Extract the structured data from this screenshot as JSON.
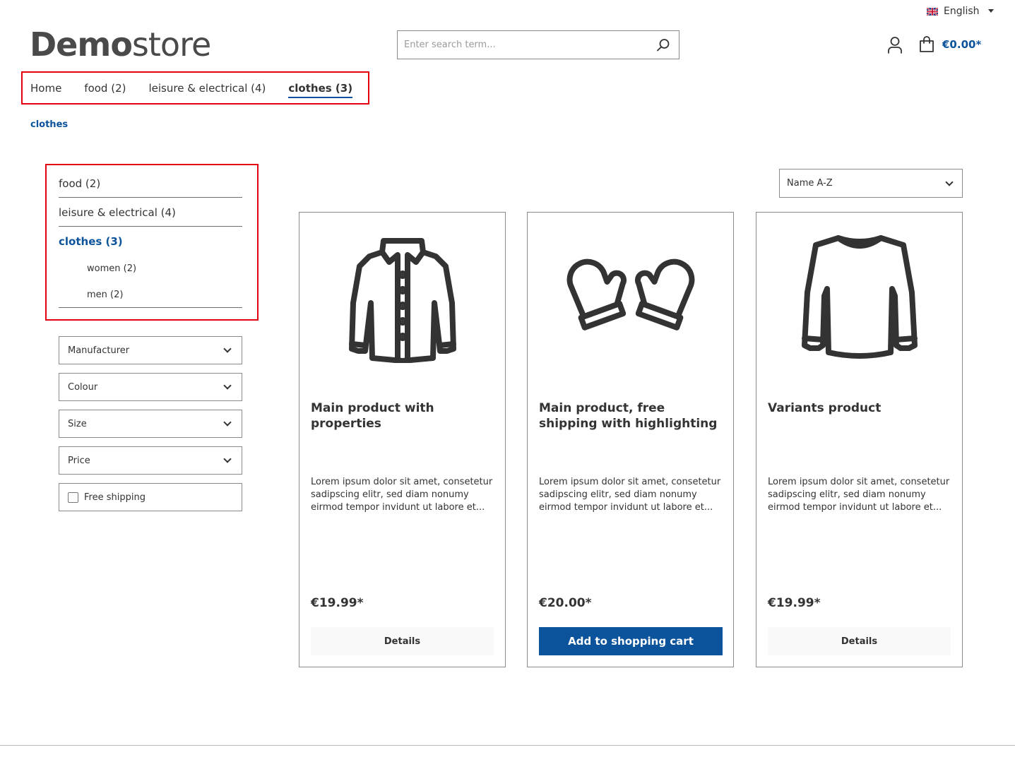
{
  "header": {
    "language": "English",
    "logo_bold": "Demo",
    "logo_light": "store",
    "search_placeholder": "Enter search term...",
    "cart_total": "€0.00*"
  },
  "main_nav": [
    {
      "label": "Home"
    },
    {
      "label": "food (2)"
    },
    {
      "label": "leisure & electrical (4)"
    },
    {
      "label": "clothes (3)"
    }
  ],
  "breadcrumb": "clothes",
  "sidebar": {
    "items": [
      {
        "label": "food (2)"
      },
      {
        "label": "leisure & electrical (4)"
      },
      {
        "label": "clothes (3)"
      }
    ],
    "subitems": [
      {
        "label": "women (2)"
      },
      {
        "label": "men (2)"
      }
    ]
  },
  "filters": {
    "manufacturer": "Manufacturer",
    "colour": "Colour",
    "size": "Size",
    "price": "Price",
    "free_shipping": "Free shipping"
  },
  "sort": {
    "selected": "Name A-Z"
  },
  "products": [
    {
      "name": "Main product with properties",
      "description": "Lorem ipsum dolor sit amet, consetetur sadipscing elitr, sed diam nonumy eirmod tempor invidunt ut labore et...",
      "price": "€19.99*",
      "button": "Details",
      "icon": "jacket-icon"
    },
    {
      "name": "Main product, free shipping with highlighting",
      "description": "Lorem ipsum dolor sit amet, consetetur sadipscing elitr, sed diam nonumy eirmod tempor invidunt ut labore et...",
      "price": "€20.00*",
      "button": "Add to shopping cart",
      "icon": "mittens-icon"
    },
    {
      "name": "Variants product",
      "description": "Lorem ipsum dolor sit amet, consetetur sadipscing elitr, sed diam nonumy eirmod tempor invidunt ut labore et...",
      "price": "€19.99*",
      "button": "Details",
      "icon": "sweater-icon"
    }
  ],
  "colors": {
    "accent": "#0b539b",
    "highlight_border": "#e3000f",
    "text": "#333333"
  }
}
